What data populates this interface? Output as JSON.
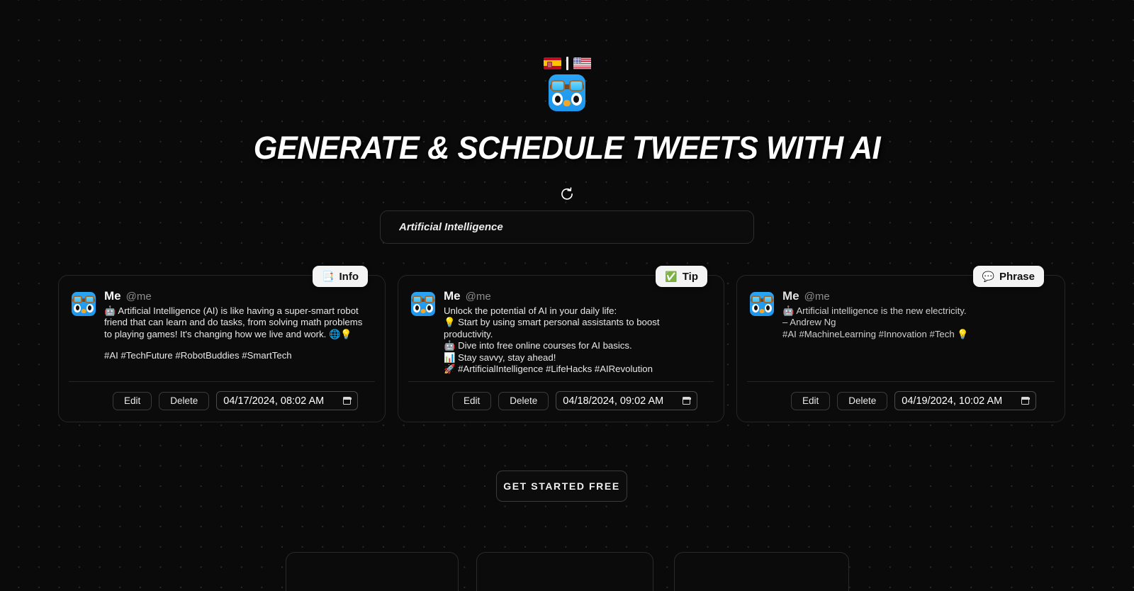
{
  "header": {
    "lang_from": "spain-flag",
    "lang_sep": "|",
    "lang_to": "usa-flag",
    "logo": "bird-goggles-logo",
    "title": "GENERATE & SCHEDULE TWEETS WITH AI"
  },
  "controls": {
    "refresh_icon": "refresh-counterclockwise-icon",
    "topic_placeholder": "Artificial Intelligence",
    "topic_value": ""
  },
  "cards": [
    {
      "badge_label": "Info",
      "badge_emoji": "📑",
      "name": "Me",
      "handle": "@me",
      "text": "🤖 Artificial Intelligence (AI) is like having a super-smart robot friend that can learn and do tasks, from solving math problems to playing games! It's changing how we live and work. 🌐💡",
      "tags": "#AI #TechFuture #RobotBuddies #SmartTech",
      "edit_label": "Edit",
      "delete_label": "Delete",
      "datetime": "04/17/2024, 08:02 AM"
    },
    {
      "badge_label": "Tip",
      "badge_emoji": "✅",
      "name": "Me",
      "handle": "@me",
      "text": "Unlock the potential of AI in your daily life:\n💡 Start by using smart personal assistants to boost productivity.\n🤖 Dive into free online courses for AI basics.\n📊 Stay savvy, stay ahead!\n🚀 #ArtificialIntelligence #LifeHacks #AIRevolution",
      "tags": "",
      "edit_label": "Edit",
      "delete_label": "Delete",
      "datetime": "04/18/2024, 09:02 AM"
    },
    {
      "badge_label": "Phrase",
      "badge_emoji": "💬",
      "name": "Me",
      "handle": "@me",
      "text": "🤖 Artificial intelligence is the new electricity.\n– Andrew Ng\n#AI #MachineLearning #Innovation #Tech 💡",
      "tags": "",
      "edit_label": "Edit",
      "delete_label": "Delete",
      "datetime": "04/19/2024, 10:02 AM"
    }
  ],
  "cta": {
    "label": "GET STARTED FREE"
  },
  "colors": {
    "background": "#0a0a0a",
    "card_bg": "#0b0b0b",
    "card_border": "#262626",
    "badge_bg": "#f4f4f4",
    "accent_blue": "#1e96ec",
    "text": "#e8e8e8",
    "muted": "#8d8d8d"
  }
}
